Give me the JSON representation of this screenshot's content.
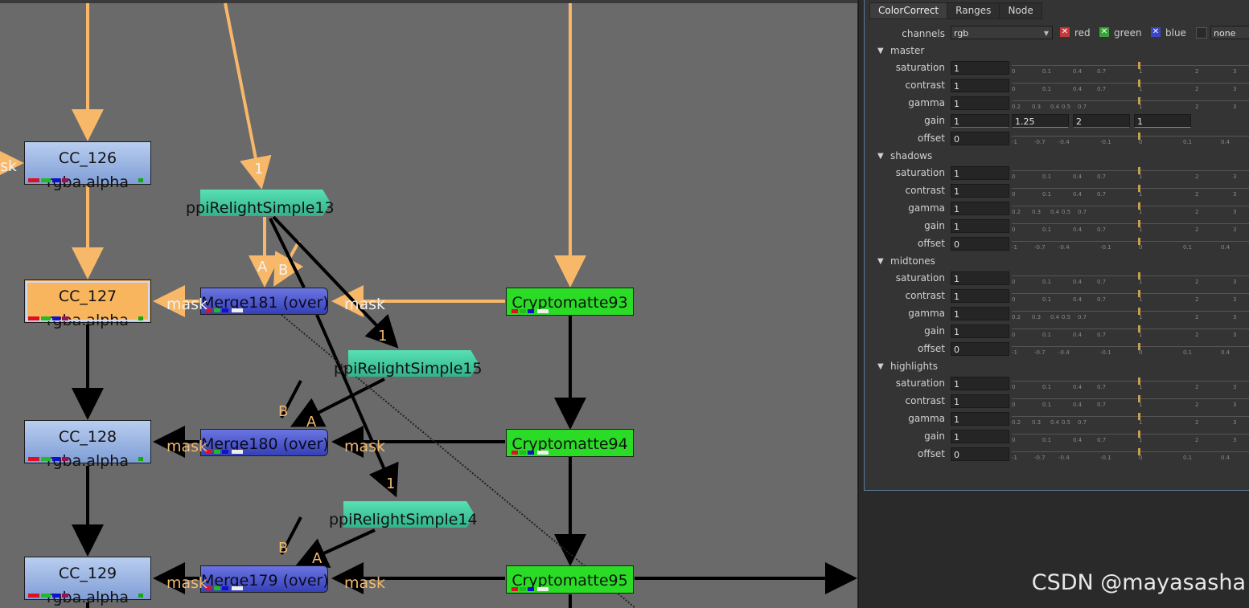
{
  "graph": {
    "nodes": {
      "cc126": {
        "label": "CC_126",
        "sub": "rgba.alpha"
      },
      "cc127": {
        "label": "CC_127",
        "sub": "rgba.alpha"
      },
      "cc128": {
        "label": "CC_128",
        "sub": "rgba.alpha"
      },
      "cc129": {
        "label": "CC_129",
        "sub": "rgba.alpha"
      },
      "merge181": {
        "label": "Merge181 (over)"
      },
      "merge180": {
        "label": "Merge180 (over)"
      },
      "merge179": {
        "label": "Merge179 (over)"
      },
      "relight13": {
        "label": "ppiRelightSimple13"
      },
      "relight15": {
        "label": "ppiRelightSimple15"
      },
      "relight14": {
        "label": "ppiRelightSimple14"
      },
      "crypto93": {
        "label": "Cryptomatte93"
      },
      "crypto94": {
        "label": "Cryptomatte94"
      },
      "crypto95": {
        "label": "Cryptomatte95"
      }
    },
    "edge_labels": {
      "mask": "mask",
      "sk": "sk",
      "a": "A",
      "b": "B",
      "one": "1"
    }
  },
  "properties": {
    "tabs": [
      "ColorCorrect",
      "Ranges",
      "Node"
    ],
    "channels": {
      "label": "channels",
      "value": "rgb",
      "red": "red",
      "green": "green",
      "blue": "blue",
      "none": "none"
    },
    "sections": [
      {
        "name": "master",
        "rows": [
          {
            "label": "saturation",
            "value": "1"
          },
          {
            "label": "contrast",
            "value": "1"
          },
          {
            "label": "gamma",
            "value": "1"
          },
          {
            "label": "gain",
            "value": "1",
            "extra": [
              "1.25",
              "2",
              "1"
            ]
          },
          {
            "label": "offset",
            "value": "0"
          }
        ]
      },
      {
        "name": "shadows",
        "rows": [
          {
            "label": "saturation",
            "value": "1"
          },
          {
            "label": "contrast",
            "value": "1"
          },
          {
            "label": "gamma",
            "value": "1"
          },
          {
            "label": "gain",
            "value": "1"
          },
          {
            "label": "offset",
            "value": "0"
          }
        ]
      },
      {
        "name": "midtones",
        "rows": [
          {
            "label": "saturation",
            "value": "1"
          },
          {
            "label": "contrast",
            "value": "1"
          },
          {
            "label": "gamma",
            "value": "1"
          },
          {
            "label": "gain",
            "value": "1"
          },
          {
            "label": "offset",
            "value": "0"
          }
        ]
      },
      {
        "name": "highlights",
        "rows": [
          {
            "label": "saturation",
            "value": "1"
          },
          {
            "label": "contrast",
            "value": "1"
          },
          {
            "label": "gamma",
            "value": "1"
          },
          {
            "label": "gain",
            "value": "1"
          },
          {
            "label": "offset",
            "value": "0"
          }
        ]
      }
    ],
    "ticks": {
      "normal": [
        "0",
        "0.1",
        "0.4",
        "0.7",
        "1",
        "2",
        "3"
      ],
      "gamma": [
        "0.2",
        "0.3",
        "0.4",
        "0.5",
        "0.7",
        "1",
        "2",
        "3"
      ],
      "offset": [
        "-1",
        "-0.7",
        "-0.4",
        "-0.1",
        "0",
        "0.1",
        "0.4"
      ]
    }
  },
  "watermark": "CSDN @mayasasha",
  "colors": {
    "wire_orange": "#f7b86a",
    "wire_black": "#000000",
    "selected_node": "#f8b55e"
  }
}
